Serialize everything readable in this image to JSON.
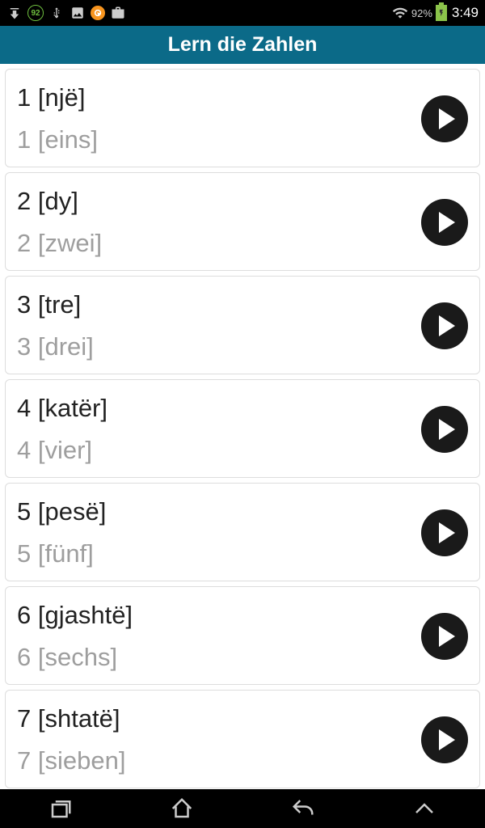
{
  "statusbar": {
    "badge_number": "92",
    "battery_percent": "92%",
    "time": "3:49"
  },
  "header": {
    "title": "Lern die Zahlen"
  },
  "items": [
    {
      "primary": "1 [një]",
      "secondary": "1 [eins]"
    },
    {
      "primary": "2 [dy]",
      "secondary": "2 [zwei]"
    },
    {
      "primary": "3 [tre]",
      "secondary": "3 [drei]"
    },
    {
      "primary": "4 [katër]",
      "secondary": "4 [vier]"
    },
    {
      "primary": "5 [pesë]",
      "secondary": "5 [fünf]"
    },
    {
      "primary": "6 [gjashtë]",
      "secondary": "6 [sechs]"
    },
    {
      "primary": "7 [shtatë]",
      "secondary": "7 [sieben]"
    }
  ]
}
